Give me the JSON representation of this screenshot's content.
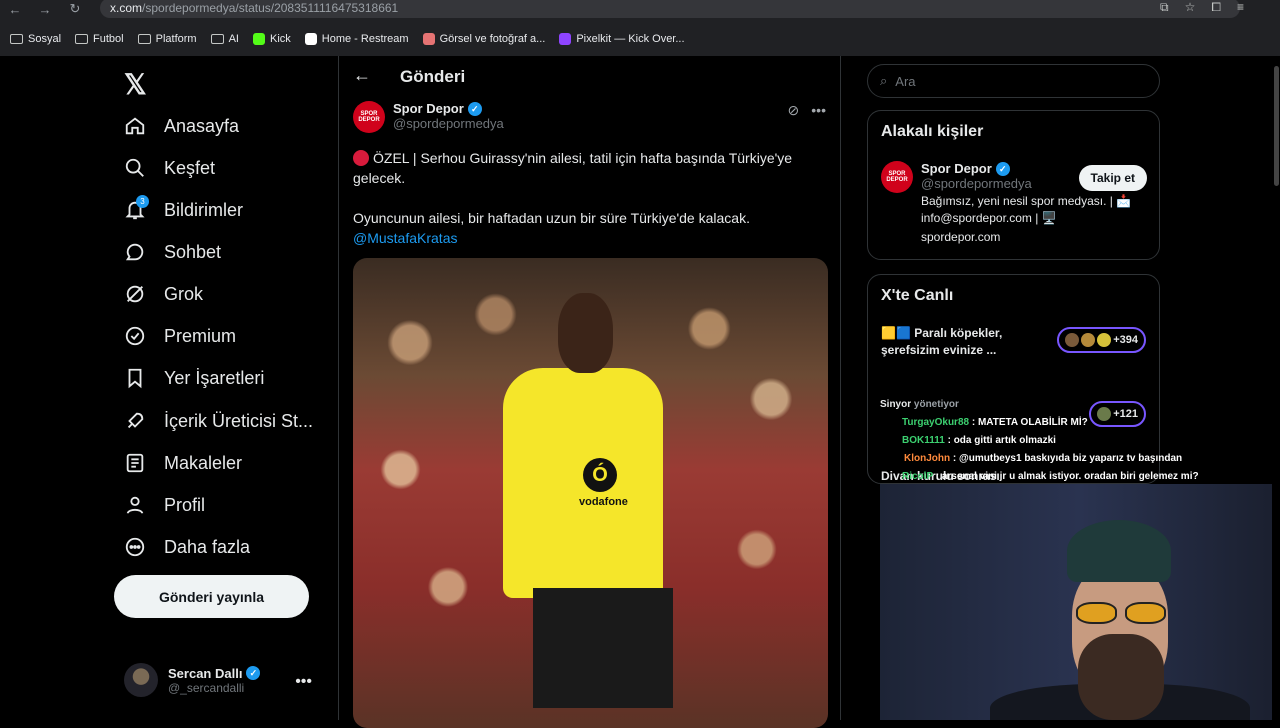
{
  "browser": {
    "url_host": "x.com",
    "url_path": "/spordepormedya/status/2083511116475318661",
    "bookmarks": [
      {
        "label": "Sosyal",
        "icon": "folder-icon"
      },
      {
        "label": "Futbol",
        "icon": "folder-icon"
      },
      {
        "label": "Platform",
        "icon": "folder-icon"
      },
      {
        "label": "AI",
        "icon": "folder-icon"
      },
      {
        "label": "Kick",
        "icon": "kick-favicon"
      },
      {
        "label": "Home - Restream",
        "icon": "restream-favicon"
      },
      {
        "label": "Görsel ve fotoğraf a...",
        "icon": "image-favicon"
      },
      {
        "label": "Pixelkit — Kick Over...",
        "icon": "pixelkit-favicon"
      }
    ]
  },
  "nav": {
    "items": [
      {
        "label": "Anasayfa",
        "icon": "home-icon"
      },
      {
        "label": "Keşfet",
        "icon": "search-icon"
      },
      {
        "label": "Bildirimler",
        "icon": "bell-icon",
        "badge": "3"
      },
      {
        "label": "Sohbet",
        "icon": "chat-icon"
      },
      {
        "label": "Grok",
        "icon": "grok-icon"
      },
      {
        "label": "Premium",
        "icon": "premium-icon"
      },
      {
        "label": "Yer İşaretleri",
        "icon": "bookmark-icon"
      },
      {
        "label": "İçerik Üreticisi St...",
        "icon": "rocket-icon"
      },
      {
        "label": "Makaleler",
        "icon": "article-icon"
      },
      {
        "label": "Profil",
        "icon": "profile-icon"
      },
      {
        "label": "Daha fazla",
        "icon": "more-circle-icon"
      }
    ],
    "post_button": "Gönderi yayınla",
    "account": {
      "name": "Sercan Dallı",
      "handle": "@_sercandalli"
    }
  },
  "main": {
    "title": "Gönderi",
    "author_name": "Spor Depor",
    "author_handle": "@spordepormedya",
    "logo_text": "SPOR DEPOR",
    "tweet_line1": "ÖZEL | Serhou Guirassy'nin ailesi, tatil için hafta başında Türkiye'ye gelecek.",
    "tweet_line2": "Oyuncunun ailesi, bir haftadan uzun bir süre Türkiye'de kalacak.",
    "mention": "@MustafaKratas",
    "photo_sponsor": "vodafone"
  },
  "right": {
    "search_placeholder": "Ara",
    "relevant": {
      "title": "Alakalı kişiler",
      "name": "Spor Depor",
      "handle": "@spordepormedya",
      "follow": "Takip et",
      "bio": "Bağımsız, yeni nesil spor medyası. | 📩 info@spordepor.com | 🖥️",
      "link": "spordepor.com"
    },
    "live": {
      "title": "X'te Canlı",
      "item1": "🟨🟦 Paralı köpekler, şerefsizim evinize ...",
      "item1_count": "+394",
      "item2_count": "+121",
      "item3": "Divan kurulu sonrası"
    }
  },
  "chat": [
    {
      "user": "Sinyor",
      "user_color": "#e7e9ea",
      "text": "yönetiyor",
      "text_color": "#9aa0a6"
    },
    {
      "user": "TurgayOkur88",
      "user_color": "#3cd070",
      "text": ": MATETA OLABİLİR Mİ?",
      "text_color": "#ffffff"
    },
    {
      "user": "BOK1111",
      "user_color": "#3cd070",
      "text": ": oda gitti artık olmazki",
      "text_color": "#ffffff"
    },
    {
      "user": "KlonJohn",
      "user_color": "#ff8a3c",
      "text": ": @umutbeys1 baskıyıda biz yaparız tv başından",
      "text_color": "#ffffff"
    },
    {
      "user": "RicolP",
      "user_color": "#3cd070",
      "text": ": arsenal vini jr u almak istiyor. oradan biri gelemez mi?",
      "text_color": "#ffffff"
    }
  ]
}
